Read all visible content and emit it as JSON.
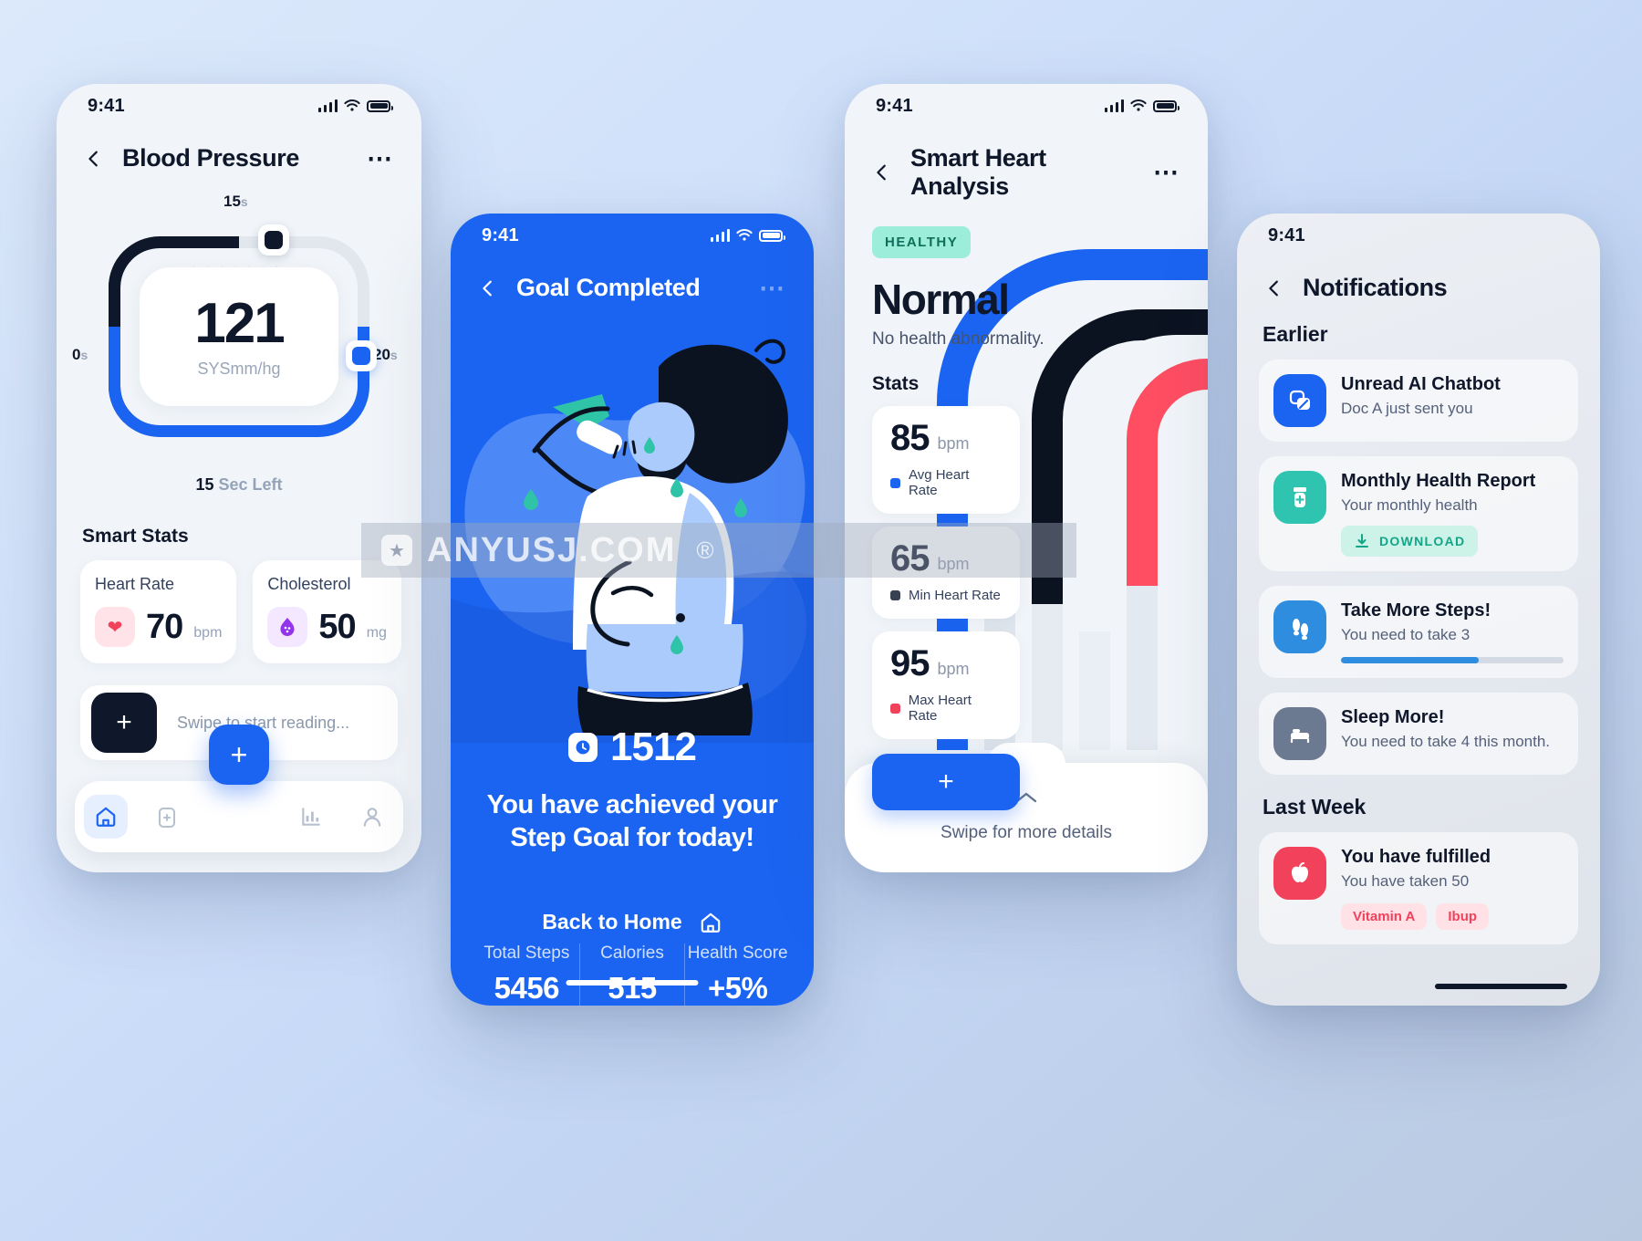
{
  "phone1": {
    "status": {
      "time": "9:41"
    },
    "header": {
      "title": "Blood Pressure",
      "back_icon": "chevron-left-icon",
      "more_icon": "more-options-icon"
    },
    "gauge": {
      "top_label": "15",
      "top_unit": "s",
      "left_label": "0",
      "left_unit": "s",
      "right_label": "20",
      "right_unit": "s",
      "value": "121",
      "unit": "SYSmm/hg",
      "countdown_value": "15",
      "countdown_label": "Sec Left"
    },
    "smart_stats": {
      "section_title": "Smart Stats",
      "cards": [
        {
          "label": "Heart Rate",
          "icon": "heart-icon",
          "value": "70",
          "unit": "bpm",
          "icon_color": "#f2415a",
          "icon_bg": "#ffe3e8"
        },
        {
          "label": "Cholesterol",
          "icon": "droplet-icon",
          "value": "50",
          "unit": "mg",
          "icon_color": "#9333ea",
          "icon_bg": "#f3e8ff"
        }
      ]
    },
    "swipe": {
      "button_icon": "plus-icon",
      "text": "Swipe to start reading..."
    },
    "fab": {
      "icon": "plus-icon"
    },
    "tabs": [
      {
        "name": "home",
        "icon": "home-icon",
        "active": true
      },
      {
        "name": "medical",
        "icon": "pill-bottle-icon",
        "active": false
      },
      {
        "name": "stats",
        "icon": "bar-chart-icon",
        "active": false
      },
      {
        "name": "profile",
        "icon": "person-icon",
        "active": false
      }
    ]
  },
  "phone2": {
    "status": {
      "time": "9:41"
    },
    "header": {
      "title": "Goal Completed",
      "back_icon": "chevron-left-icon",
      "more_icon": "more-options-icon"
    },
    "steps": {
      "icon": "step-counter-icon",
      "count": "1512"
    },
    "message": "You have achieved your Step Goal for today!",
    "metrics": [
      {
        "label": "Total Steps",
        "value": "5456"
      },
      {
        "label": "Calories",
        "value": "515"
      },
      {
        "label": "Health Score",
        "value": "+5%"
      }
    ],
    "back_home": {
      "label": "Back to Home",
      "icon": "home-icon"
    },
    "accent": "#1b64f2"
  },
  "phone3": {
    "status": {
      "time": "9:41"
    },
    "header": {
      "title": "Smart Heart Analysis",
      "back_icon": "chevron-left-icon",
      "more_icon": "more-options-icon"
    },
    "badge": "HEALTHY",
    "headline": "Normal",
    "subtext": "No health abnormality.",
    "stats_title": "Stats",
    "stats": [
      {
        "value": "85",
        "unit": "bpm",
        "label": "Avg Heart Rate",
        "color": "#1b64f2"
      },
      {
        "value": "65",
        "unit": "bpm",
        "label": "Min Heart Rate",
        "color": "#374151"
      },
      {
        "value": "95",
        "unit": "bpm",
        "label": "Max Heart Rate",
        "color": "#f2415a"
      }
    ],
    "add_button": {
      "icon": "plus-icon"
    },
    "sheet": {
      "chevron": "chevron-up-icon",
      "text": "Swipe for more details"
    }
  },
  "phone4": {
    "status": {
      "time": "9:41"
    },
    "header": {
      "title": "Notifications",
      "back_icon": "chevron-left-icon"
    },
    "sections": [
      {
        "title": "Earlier",
        "items": [
          {
            "title": "Unread AI Chatbot",
            "desc": "Doc A just sent you",
            "icon": "chat-bubbles-icon",
            "icon_bg": "#1b64f2"
          },
          {
            "title": "Monthly Health Report",
            "desc": "Your monthly health",
            "icon": "pill-bottle-icon",
            "icon_bg": "#2ec4b0",
            "download_label": "DOWNLOAD",
            "download_icon": "download-icon"
          },
          {
            "title": "Take More Steps!",
            "desc": "You need to take 3",
            "icon": "footsteps-icon",
            "icon_bg": "#2f8de0",
            "progress": 62
          },
          {
            "title": "Sleep More!",
            "desc": "You need to take 4 this month.",
            "icon": "bed-icon",
            "icon_bg": "#6b7a91"
          }
        ]
      },
      {
        "title": "Last Week",
        "items": [
          {
            "title": "You have fulfilled",
            "desc": "You have taken 50",
            "icon": "apple-icon",
            "icon_bg": "#f2415a",
            "tags": [
              "Vitamin A",
              "Ibup"
            ]
          }
        ]
      }
    ]
  },
  "watermark": {
    "text": "ANYUSJ.COM",
    "registered": "®",
    "star": "★"
  }
}
